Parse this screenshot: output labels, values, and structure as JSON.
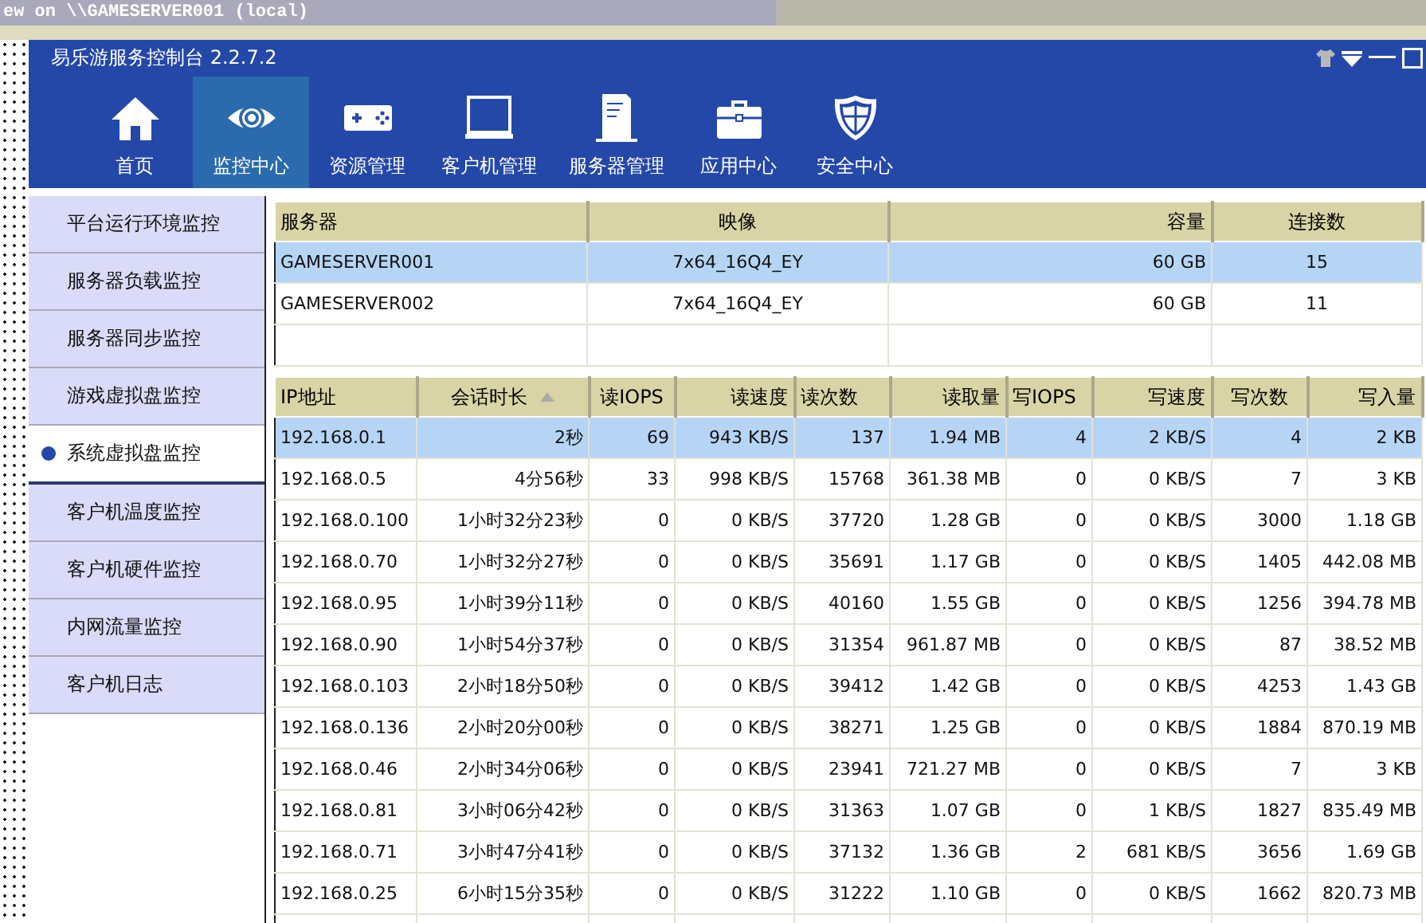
{
  "background_window": {
    "title": "ew on \\\\GAMESERVER001 (local)"
  },
  "window": {
    "title": "易乐游服务控制台 2.2.7.2"
  },
  "nav": [
    {
      "label": "首页",
      "kind": "home",
      "selected": false
    },
    {
      "label": "监控中心",
      "kind": "eye",
      "selected": true
    },
    {
      "label": "资源管理",
      "kind": "gamepad",
      "selected": false
    },
    {
      "label": "客户机管理",
      "kind": "monitor",
      "selected": false
    },
    {
      "label": "服务器管理",
      "kind": "server",
      "selected": false
    },
    {
      "label": "应用中心",
      "kind": "toolbox",
      "selected": false
    },
    {
      "label": "安全中心",
      "kind": "shield",
      "selected": false
    }
  ],
  "sidebar": {
    "items": [
      {
        "label": "平台运行环境监控",
        "selected": false
      },
      {
        "label": "服务器负载监控",
        "selected": false
      },
      {
        "label": "服务器同步监控",
        "selected": false
      },
      {
        "label": "游戏虚拟盘监控",
        "selected": false
      },
      {
        "label": "系统虚拟盘监控",
        "selected": true
      },
      {
        "label": "客户机温度监控",
        "selected": false
      },
      {
        "label": "客户机硬件监控",
        "selected": false
      },
      {
        "label": "内网流量监控",
        "selected": false
      },
      {
        "label": "客户机日志",
        "selected": false
      }
    ]
  },
  "server_table": {
    "columns": [
      {
        "label": "服务器"
      },
      {
        "label": "映像"
      },
      {
        "label": "容量"
      },
      {
        "label": "连接数"
      }
    ],
    "rows": [
      {
        "cells": [
          "GAMESERVER001",
          "7x64_16Q4_EY",
          "60 GB",
          "15"
        ],
        "selected": true
      },
      {
        "cells": [
          "GAMESERVER002",
          "7x64_16Q4_EY",
          "60 GB",
          "11"
        ],
        "selected": false
      }
    ]
  },
  "session_table": {
    "columns": [
      {
        "label": "IP地址",
        "sorted": false
      },
      {
        "label": "会话时长",
        "sorted": true
      },
      {
        "label": "读IOPS",
        "sorted": false
      },
      {
        "label": "读速度",
        "sorted": false
      },
      {
        "label": "读次数",
        "sorted": false
      },
      {
        "label": "读取量",
        "sorted": false
      },
      {
        "label": "写IOPS",
        "sorted": false
      },
      {
        "label": "写速度",
        "sorted": false
      },
      {
        "label": "写次数",
        "sorted": false
      },
      {
        "label": "写入量",
        "sorted": false
      }
    ],
    "rows": [
      {
        "cells": [
          "192.168.0.1",
          "2秒",
          "69",
          "943 KB/S",
          "137",
          "1.94 MB",
          "4",
          "2 KB/S",
          "4",
          "2 KB"
        ],
        "selected": true
      },
      {
        "cells": [
          "192.168.0.5",
          "4分56秒",
          "33",
          "998 KB/S",
          "15768",
          "361.38 MB",
          "0",
          "0 KB/S",
          "7",
          "3 KB"
        ],
        "selected": false
      },
      {
        "cells": [
          "192.168.0.100",
          "1小时32分23秒",
          "0",
          "0 KB/S",
          "37720",
          "1.28 GB",
          "0",
          "0 KB/S",
          "3000",
          "1.18 GB"
        ],
        "selected": false
      },
      {
        "cells": [
          "192.168.0.70",
          "1小时32分27秒",
          "0",
          "0 KB/S",
          "35691",
          "1.17 GB",
          "0",
          "0 KB/S",
          "1405",
          "442.08 MB"
        ],
        "selected": false
      },
      {
        "cells": [
          "192.168.0.95",
          "1小时39分11秒",
          "0",
          "0 KB/S",
          "40160",
          "1.55 GB",
          "0",
          "0 KB/S",
          "1256",
          "394.78 MB"
        ],
        "selected": false
      },
      {
        "cells": [
          "192.168.0.90",
          "1小时54分37秒",
          "0",
          "0 KB/S",
          "31354",
          "961.87 MB",
          "0",
          "0 KB/S",
          "87",
          "38.52 MB"
        ],
        "selected": false
      },
      {
        "cells": [
          "192.168.0.103",
          "2小时18分50秒",
          "0",
          "0 KB/S",
          "39412",
          "1.42 GB",
          "0",
          "0 KB/S",
          "4253",
          "1.43 GB"
        ],
        "selected": false
      },
      {
        "cells": [
          "192.168.0.136",
          "2小时20分00秒",
          "0",
          "0 KB/S",
          "38271",
          "1.25 GB",
          "0",
          "0 KB/S",
          "1884",
          "870.19 MB"
        ],
        "selected": false
      },
      {
        "cells": [
          "192.168.0.46",
          "2小时34分06秒",
          "0",
          "0 KB/S",
          "23941",
          "721.27 MB",
          "0",
          "0 KB/S",
          "7",
          "3 KB"
        ],
        "selected": false
      },
      {
        "cells": [
          "192.168.0.81",
          "3小时06分42秒",
          "0",
          "0 KB/S",
          "31363",
          "1.07 GB",
          "0",
          "1 KB/S",
          "1827",
          "835.49 MB"
        ],
        "selected": false
      },
      {
        "cells": [
          "192.168.0.71",
          "3小时47分41秒",
          "0",
          "0 KB/S",
          "37132",
          "1.36 GB",
          "2",
          "681 KB/S",
          "3656",
          "1.69 GB"
        ],
        "selected": false
      },
      {
        "cells": [
          "192.168.0.25",
          "6小时15分35秒",
          "0",
          "0 KB/S",
          "31222",
          "1.10 GB",
          "0",
          "0 KB/S",
          "1662",
          "820.73 MB"
        ],
        "selected": false
      }
    ]
  }
}
